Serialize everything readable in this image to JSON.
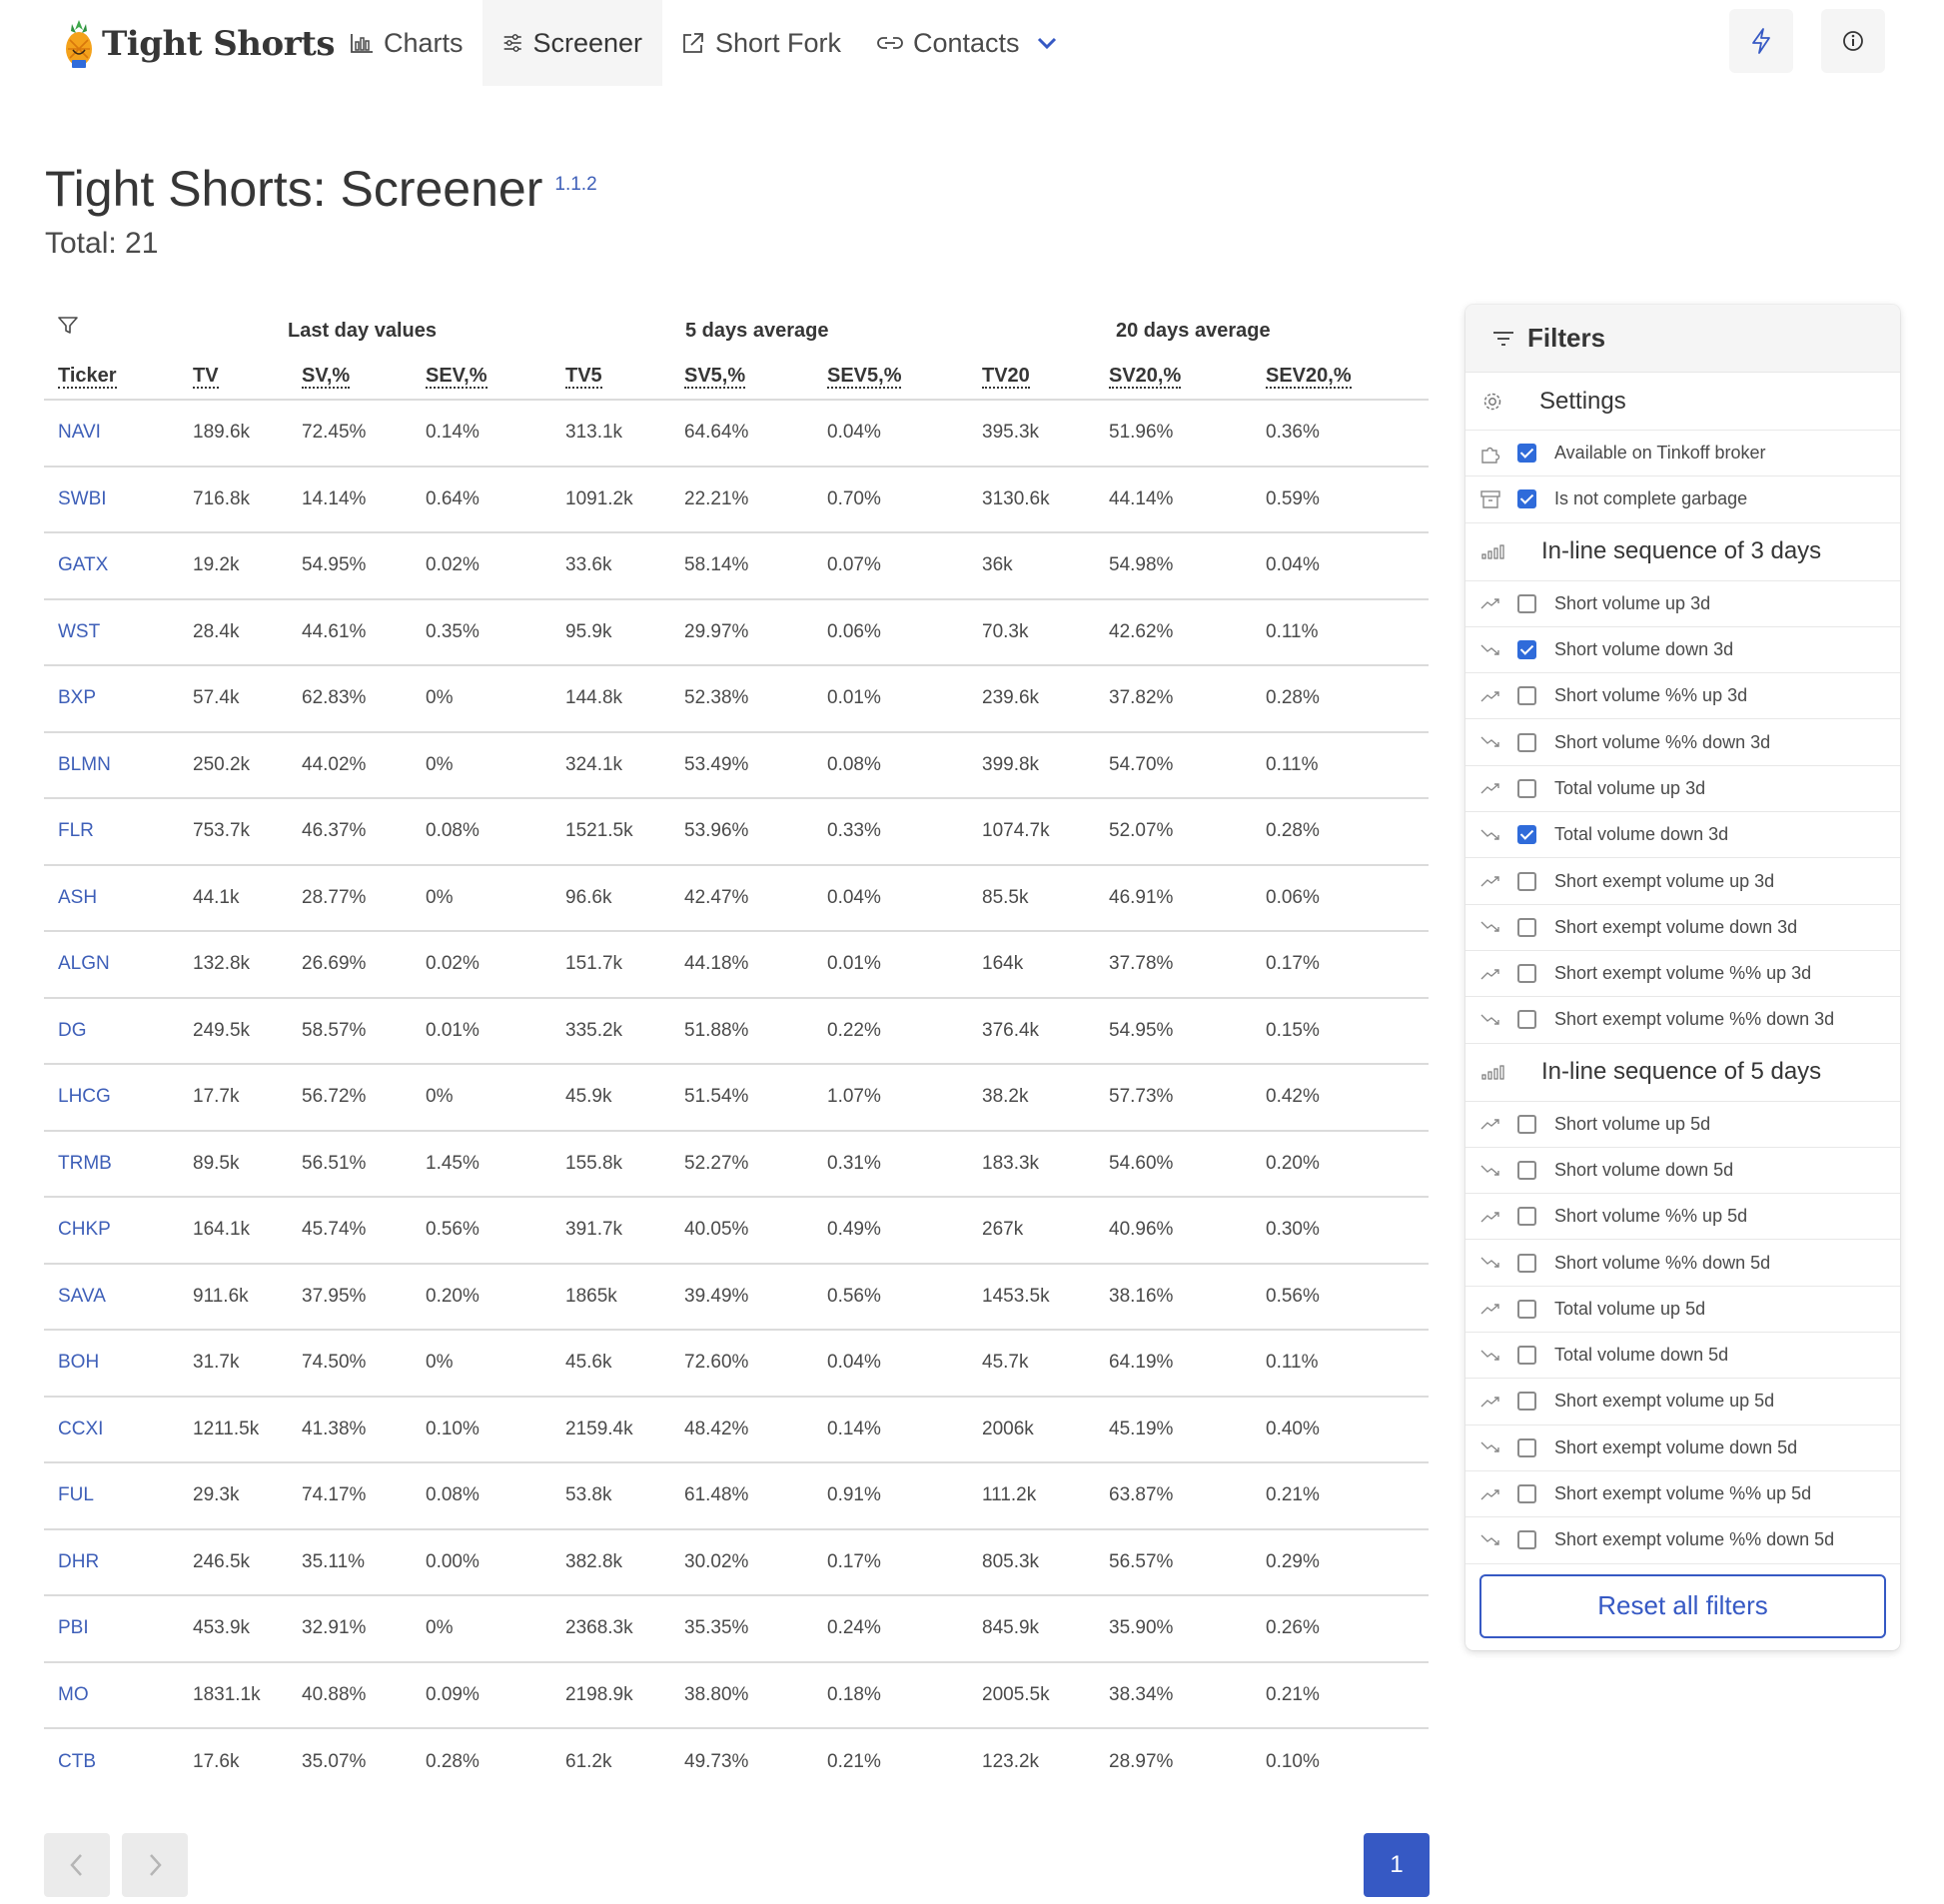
{
  "nav": {
    "brand": "Tight Shorts",
    "items": [
      {
        "label": "Charts",
        "icon": "bar-chart-icon"
      },
      {
        "label": "Screener",
        "icon": "sliders-icon"
      },
      {
        "label": "Short Fork",
        "icon": "external-link-icon"
      },
      {
        "label": "Contacts",
        "icon": "link-icon"
      }
    ],
    "active": "Screener"
  },
  "page": {
    "title": "Tight Shorts: Screener",
    "version": "1.1.2",
    "total": "Total: 21"
  },
  "table": {
    "groups": [
      "Last day values",
      "5 days average",
      "20 days average"
    ],
    "columns": [
      "Ticker",
      "TV",
      "SV,%",
      "SEV,%",
      "TV5",
      "SV5,%",
      "SEV5,%",
      "TV20",
      "SV20,%",
      "SEV20,%"
    ],
    "rows": [
      [
        "NAVI",
        "189.6k",
        "72.45%",
        "0.14%",
        "313.1k",
        "64.64%",
        "0.04%",
        "395.3k",
        "51.96%",
        "0.36%"
      ],
      [
        "SWBI",
        "716.8k",
        "14.14%",
        "0.64%",
        "1091.2k",
        "22.21%",
        "0.70%",
        "3130.6k",
        "44.14%",
        "0.59%"
      ],
      [
        "GATX",
        "19.2k",
        "54.95%",
        "0.02%",
        "33.6k",
        "58.14%",
        "0.07%",
        "36k",
        "54.98%",
        "0.04%"
      ],
      [
        "WST",
        "28.4k",
        "44.61%",
        "0.35%",
        "95.9k",
        "29.97%",
        "0.06%",
        "70.3k",
        "42.62%",
        "0.11%"
      ],
      [
        "BXP",
        "57.4k",
        "62.83%",
        "0%",
        "144.8k",
        "52.38%",
        "0.01%",
        "239.6k",
        "37.82%",
        "0.28%"
      ],
      [
        "BLMN",
        "250.2k",
        "44.02%",
        "0%",
        "324.1k",
        "53.49%",
        "0.08%",
        "399.8k",
        "54.70%",
        "0.11%"
      ],
      [
        "FLR",
        "753.7k",
        "46.37%",
        "0.08%",
        "1521.5k",
        "53.96%",
        "0.33%",
        "1074.7k",
        "52.07%",
        "0.28%"
      ],
      [
        "ASH",
        "44.1k",
        "28.77%",
        "0%",
        "96.6k",
        "42.47%",
        "0.04%",
        "85.5k",
        "46.91%",
        "0.06%"
      ],
      [
        "ALGN",
        "132.8k",
        "26.69%",
        "0.02%",
        "151.7k",
        "44.18%",
        "0.01%",
        "164k",
        "37.78%",
        "0.17%"
      ],
      [
        "DG",
        "249.5k",
        "58.57%",
        "0.01%",
        "335.2k",
        "51.88%",
        "0.22%",
        "376.4k",
        "54.95%",
        "0.15%"
      ],
      [
        "LHCG",
        "17.7k",
        "56.72%",
        "0%",
        "45.9k",
        "51.54%",
        "1.07%",
        "38.2k",
        "57.73%",
        "0.42%"
      ],
      [
        "TRMB",
        "89.5k",
        "56.51%",
        "1.45%",
        "155.8k",
        "52.27%",
        "0.31%",
        "183.3k",
        "54.60%",
        "0.20%"
      ],
      [
        "CHKP",
        "164.1k",
        "45.74%",
        "0.56%",
        "391.7k",
        "40.05%",
        "0.49%",
        "267k",
        "40.96%",
        "0.30%"
      ],
      [
        "SAVA",
        "911.6k",
        "37.95%",
        "0.20%",
        "1865k",
        "39.49%",
        "0.56%",
        "1453.5k",
        "38.16%",
        "0.56%"
      ],
      [
        "BOH",
        "31.7k",
        "74.50%",
        "0%",
        "45.6k",
        "72.60%",
        "0.04%",
        "45.7k",
        "64.19%",
        "0.11%"
      ],
      [
        "CCXI",
        "1211.5k",
        "41.38%",
        "0.10%",
        "2159.4k",
        "48.42%",
        "0.14%",
        "2006k",
        "45.19%",
        "0.40%"
      ],
      [
        "FUL",
        "29.3k",
        "74.17%",
        "0.08%",
        "53.8k",
        "61.48%",
        "0.91%",
        "111.2k",
        "63.87%",
        "0.21%"
      ],
      [
        "DHR",
        "246.5k",
        "35.11%",
        "0.00%",
        "382.8k",
        "30.02%",
        "0.17%",
        "805.3k",
        "56.57%",
        "0.29%"
      ],
      [
        "PBI",
        "453.9k",
        "32.91%",
        "0%",
        "2368.3k",
        "35.35%",
        "0.24%",
        "845.9k",
        "35.90%",
        "0.26%"
      ],
      [
        "MO",
        "1831.1k",
        "40.88%",
        "0.09%",
        "2198.9k",
        "38.80%",
        "0.18%",
        "2005.5k",
        "38.34%",
        "0.21%"
      ],
      [
        "CTB",
        "17.6k",
        "35.07%",
        "0.28%",
        "61.2k",
        "49.73%",
        "0.21%",
        "123.2k",
        "28.97%",
        "0.10%"
      ]
    ]
  },
  "pagination": {
    "current": "1"
  },
  "filters": {
    "title": "Filters",
    "sections": [
      {
        "title": "Settings",
        "icon": "gear-icon",
        "items": [
          {
            "label": "Available on Tinkoff broker",
            "checked": true,
            "icon": "puzzle-icon"
          },
          {
            "label": "Is not complete garbage",
            "checked": true,
            "icon": "archive-icon"
          }
        ]
      },
      {
        "title": "In-line sequence of 3 days",
        "icon": "signal-bars-icon",
        "items": [
          {
            "label": "Short volume up 3d",
            "checked": false,
            "icon": "trend-up-icon"
          },
          {
            "label": "Short volume down 3d",
            "checked": true,
            "icon": "trend-down-icon"
          },
          {
            "label": "Short volume %% up 3d",
            "checked": false,
            "icon": "trend-up-icon"
          },
          {
            "label": "Short volume %% down 3d",
            "checked": false,
            "icon": "trend-down-icon"
          },
          {
            "label": "Total volume up 3d",
            "checked": false,
            "icon": "trend-up-icon"
          },
          {
            "label": "Total volume down 3d",
            "checked": true,
            "icon": "trend-down-icon"
          },
          {
            "label": "Short exempt volume up 3d",
            "checked": false,
            "icon": "trend-up-icon"
          },
          {
            "label": "Short exempt volume down 3d",
            "checked": false,
            "icon": "trend-down-icon"
          },
          {
            "label": "Short exempt volume %% up 3d",
            "checked": false,
            "icon": "trend-up-icon"
          },
          {
            "label": "Short exempt volume %% down 3d",
            "checked": false,
            "icon": "trend-down-icon"
          }
        ]
      },
      {
        "title": "In-line sequence of 5 days",
        "icon": "signal-bars-icon",
        "items": [
          {
            "label": "Short volume up 5d",
            "checked": false,
            "icon": "trend-up-icon"
          },
          {
            "label": "Short volume down 5d",
            "checked": false,
            "icon": "trend-down-icon"
          },
          {
            "label": "Short volume %% up 5d",
            "checked": false,
            "icon": "trend-up-icon"
          },
          {
            "label": "Short volume %% down 5d",
            "checked": false,
            "icon": "trend-down-icon"
          },
          {
            "label": "Total volume up 5d",
            "checked": false,
            "icon": "trend-up-icon"
          },
          {
            "label": "Total volume down 5d",
            "checked": false,
            "icon": "trend-down-icon"
          },
          {
            "label": "Short exempt volume up 5d",
            "checked": false,
            "icon": "trend-up-icon"
          },
          {
            "label": "Short exempt volume down 5d",
            "checked": false,
            "icon": "trend-down-icon"
          },
          {
            "label": "Short exempt volume %% up 5d",
            "checked": false,
            "icon": "trend-up-icon"
          },
          {
            "label": "Short exempt volume %% down 5d",
            "checked": false,
            "icon": "trend-down-icon"
          }
        ]
      }
    ],
    "reset_label": "Reset all filters"
  },
  "colors": {
    "accent": "#3659c4",
    "link": "#3e5fb8",
    "checkbox": "#2f6bda"
  }
}
